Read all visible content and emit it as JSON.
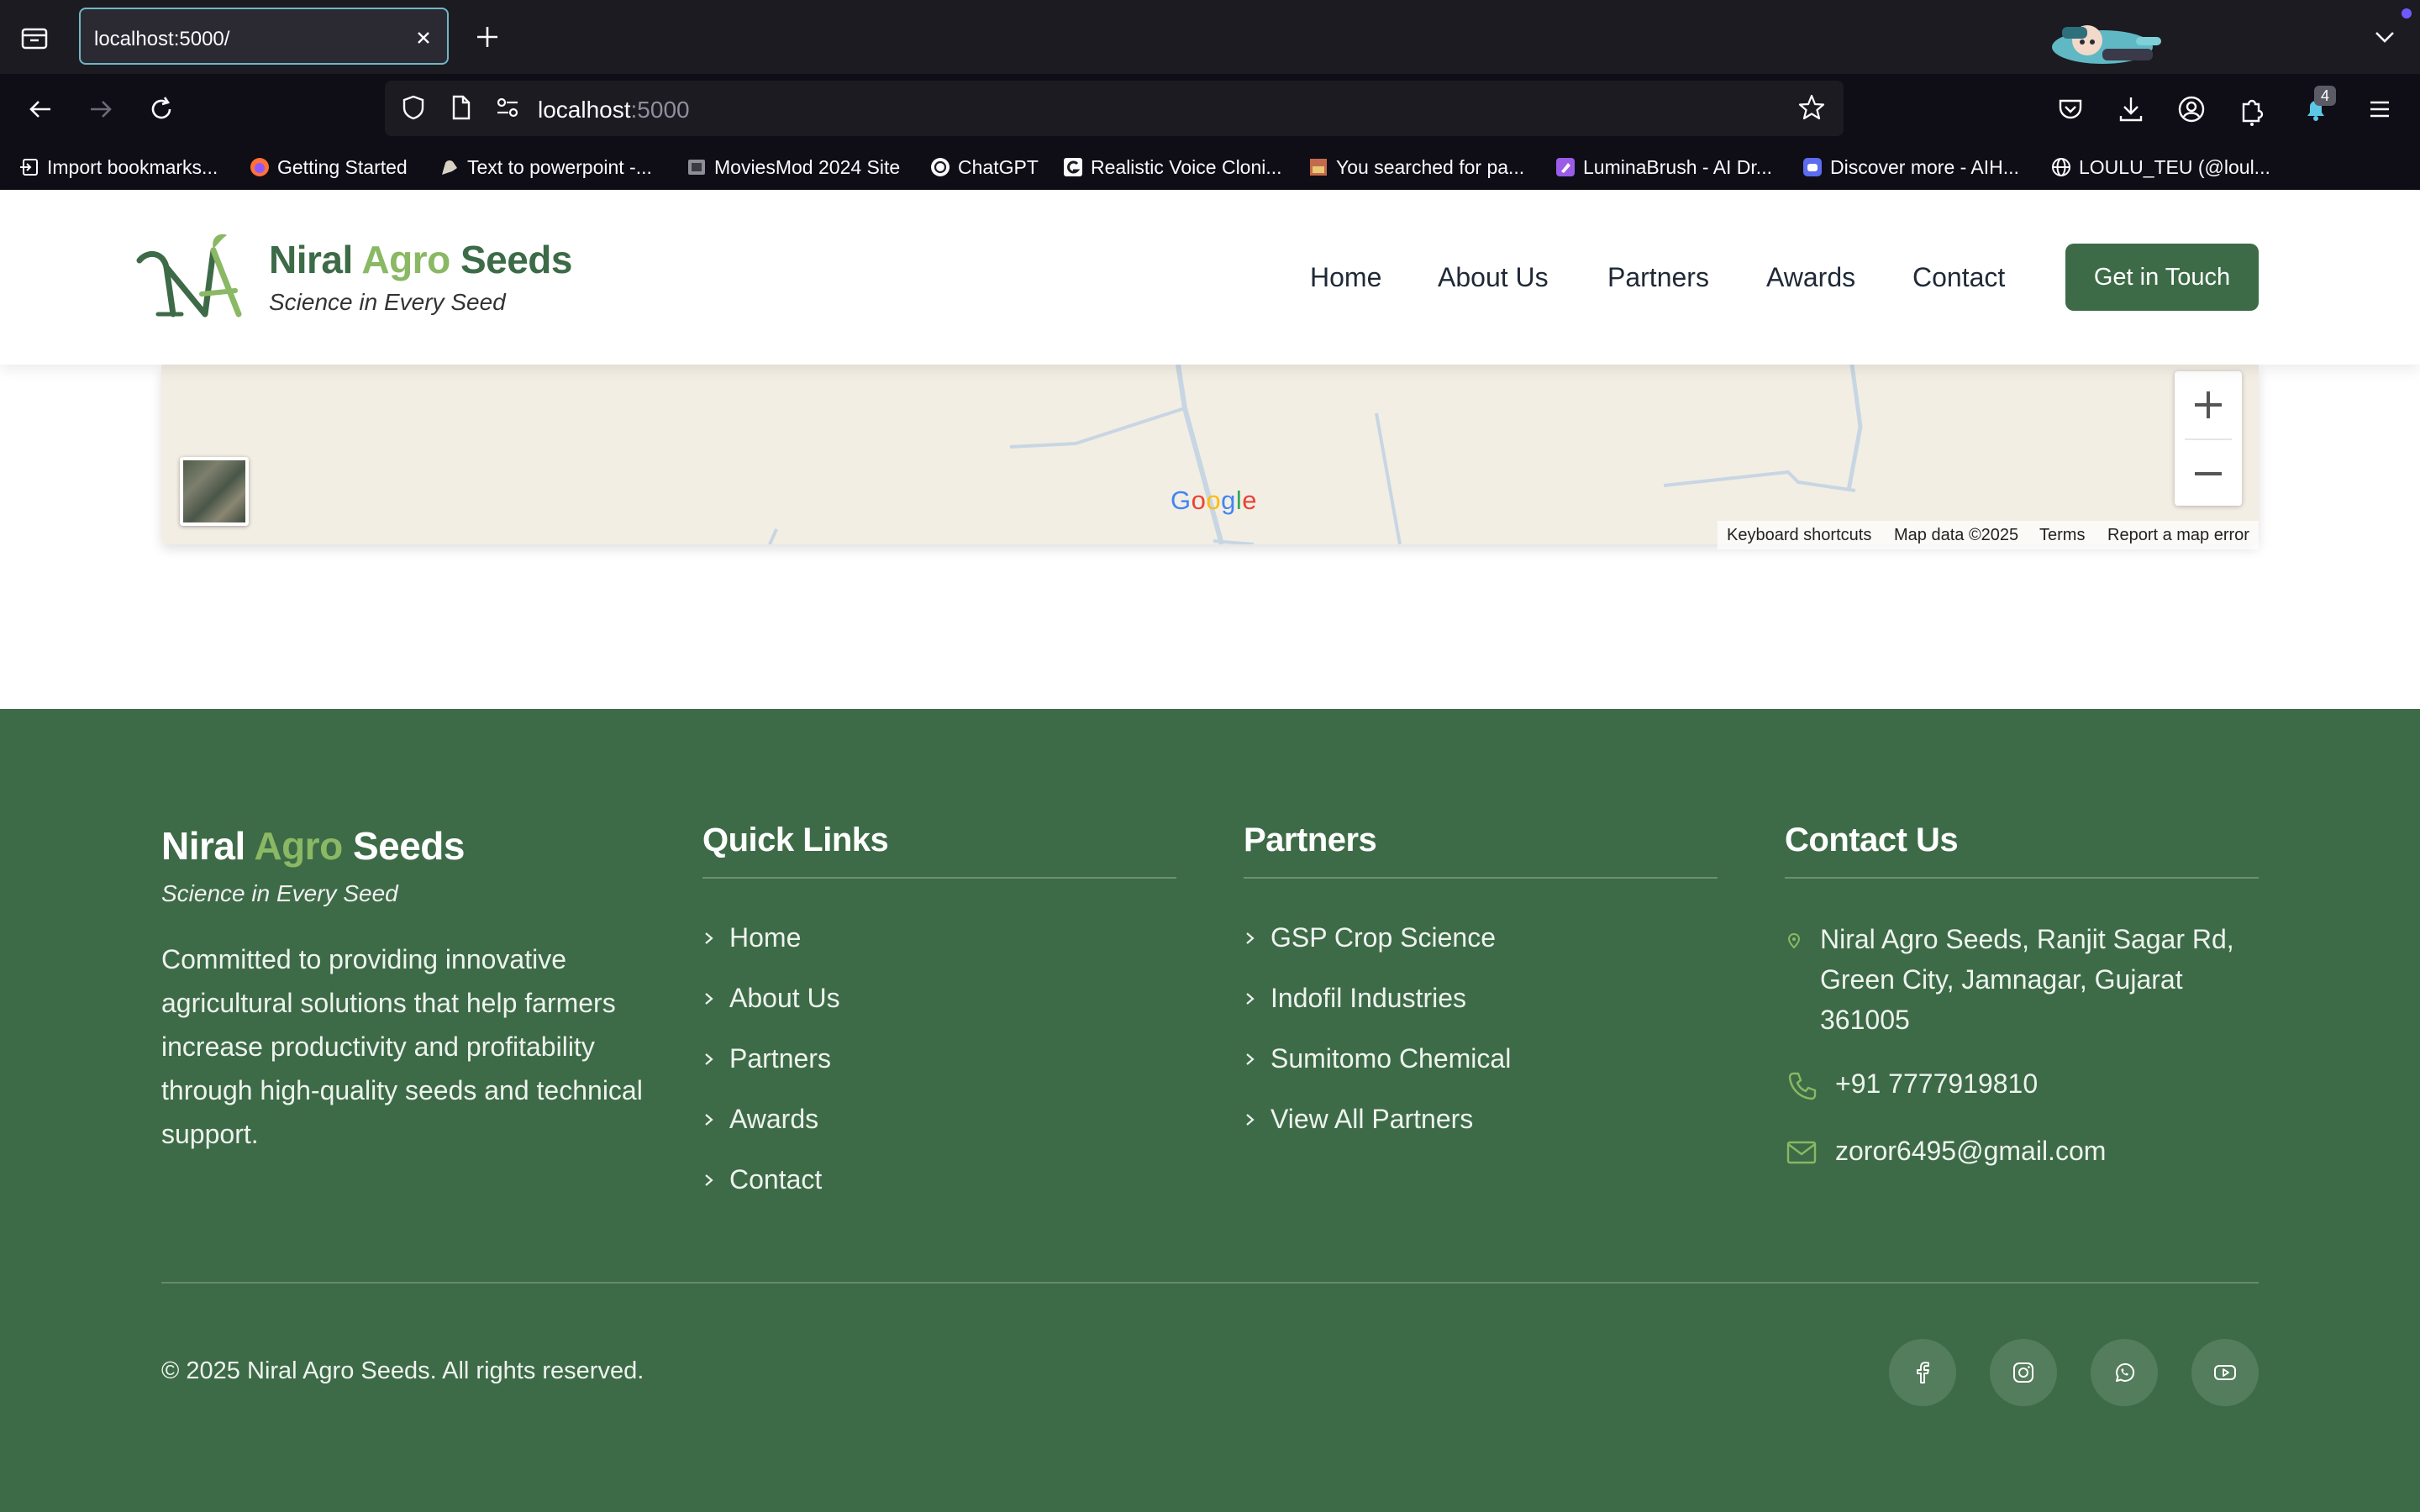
{
  "browser": {
    "tab_title": "localhost:5000/",
    "url_host": "localhost",
    "url_port": ":5000",
    "extension_badge": "4",
    "bookmarks": [
      {
        "label": "Import bookmarks...",
        "icon": "import-icon"
      },
      {
        "label": "Getting Started",
        "icon": "firefox-icon"
      },
      {
        "label": "Text to powerpoint -...",
        "icon": "arm-icon"
      },
      {
        "label": "MoviesMod 2024 Site",
        "icon": "movie-icon"
      },
      {
        "label": "ChatGPT",
        "icon": "chatgpt-icon"
      },
      {
        "label": "Realistic Voice Cloni...",
        "icon": "g-icon"
      },
      {
        "label": "You searched for pa...",
        "icon": "image-icon"
      },
      {
        "label": "LuminaBrush - AI Dr...",
        "icon": "brush-icon"
      },
      {
        "label": "Discover more - AIH...",
        "icon": "bot-icon"
      },
      {
        "label": "LOULU_TEU (@loul...",
        "icon": "globe-icon"
      }
    ]
  },
  "header": {
    "brand_first": "Niral",
    "brand_mid": "Agro",
    "brand_last": "Seeds",
    "tagline": "Science in Every Seed",
    "nav": [
      "Home",
      "About Us",
      "Partners",
      "Awards",
      "Contact"
    ],
    "cta": "Get in Touch"
  },
  "map": {
    "logo": [
      "G",
      "o",
      "o",
      "g",
      "l",
      "e"
    ],
    "attribution": [
      "Keyboard shortcuts",
      "Map data ©2025",
      "Terms",
      "Report a map error"
    ]
  },
  "footer": {
    "brand_first": "Niral",
    "brand_mid": "Agro",
    "brand_last": "Seeds",
    "tagline": "Science in Every Seed",
    "description": "Committed to providing innovative agricultural solutions that help farmers increase productivity and profitability through high-quality seeds and technical support.",
    "quick_links_title": "Quick Links",
    "quick_links": [
      "Home",
      "About Us",
      "Partners",
      "Awards",
      "Contact"
    ],
    "partners_title": "Partners",
    "partners": [
      "GSP Crop Science",
      "Indofil Industries",
      "Sumitomo Chemical",
      "View All Partners"
    ],
    "contact_title": "Contact Us",
    "address": "Niral Agro Seeds, Ranjit Sagar Rd, Green City, Jamnagar, Gujarat 361005",
    "phone": "+91 7777919810",
    "email": "zoror6495@gmail.com",
    "copyright": "© 2025 Niral Agro Seeds. All rights reserved.",
    "social": [
      "facebook-icon",
      "instagram-icon",
      "whatsapp-icon",
      "youtube-icon"
    ]
  },
  "colors": {
    "brand_green": "#3d6b47",
    "brand_light_green": "#8ab864",
    "browser_dark": "#1c1b22",
    "tab_border": "#6fb7c6"
  }
}
